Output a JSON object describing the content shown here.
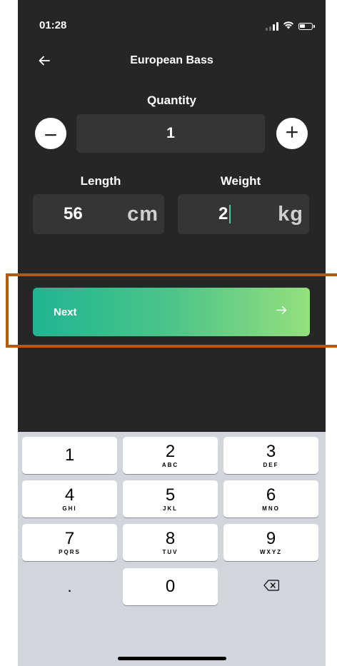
{
  "status_bar": {
    "time": "01:28",
    "icons": [
      "signal-icon",
      "wifi-icon",
      "battery-icon"
    ]
  },
  "header": {
    "back_icon": "arrow-left-icon",
    "title": "European Bass"
  },
  "quantity": {
    "label": "Quantity",
    "value": "1",
    "decrement_icon": "minus-icon",
    "increment_icon": "plus-icon"
  },
  "length": {
    "label": "Length",
    "value": "56",
    "unit": "cm"
  },
  "weight": {
    "label": "Weight",
    "value": "2",
    "unit": "kg"
  },
  "next_button": {
    "label": "Next",
    "icon": "arrow-right-icon"
  },
  "keypad": {
    "keys": [
      {
        "digit": "1",
        "letters": ""
      },
      {
        "digit": "2",
        "letters": "ABC"
      },
      {
        "digit": "3",
        "letters": "DEF"
      },
      {
        "digit": "4",
        "letters": "GHI"
      },
      {
        "digit": "5",
        "letters": "JKL"
      },
      {
        "digit": "6",
        "letters": "MNO"
      },
      {
        "digit": "7",
        "letters": "PQRS"
      },
      {
        "digit": "8",
        "letters": "TUV"
      },
      {
        "digit": "9",
        "letters": "WXYZ"
      }
    ],
    "decimal": ".",
    "zero": "0",
    "delete_icon": "backspace-icon"
  },
  "colors": {
    "background": "#262626",
    "field": "#353535",
    "accent_start": "#1fb592",
    "accent_end": "#95df7e",
    "highlight": "#b35910",
    "keypad_bg": "#d2d5db"
  }
}
